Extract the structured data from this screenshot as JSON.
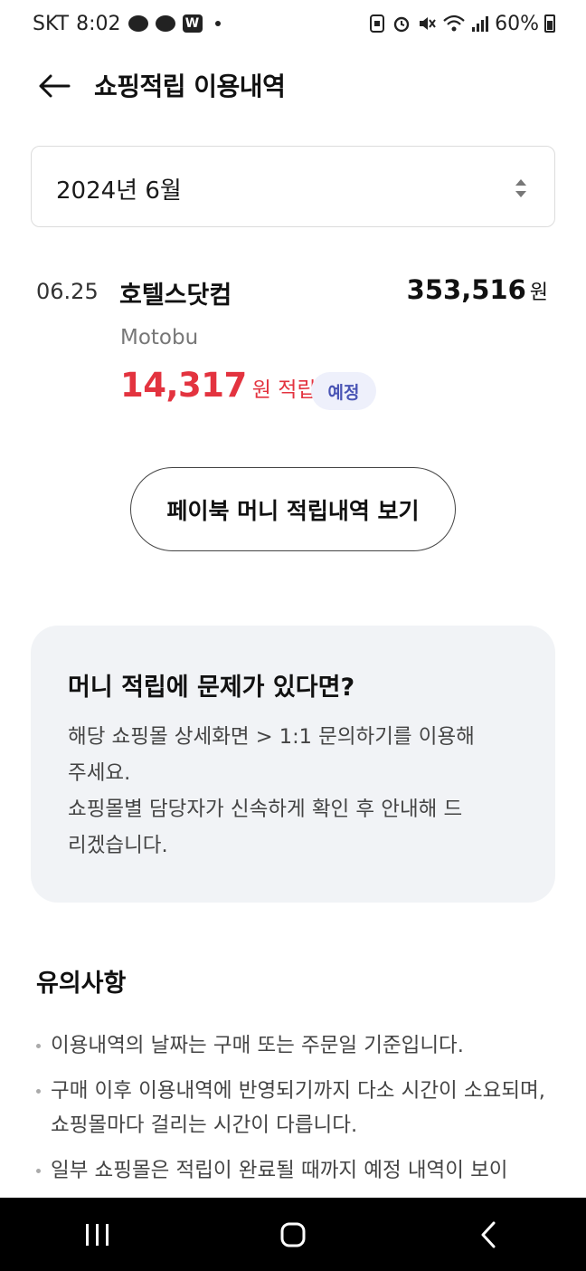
{
  "status_bar": {
    "carrier": "SKT",
    "time": "8:02",
    "app_badge": "W",
    "battery_text": "60%"
  },
  "header": {
    "title": "쇼핑적립 이용내역"
  },
  "month_select": {
    "value": "2024년 6월"
  },
  "transaction": {
    "date": "06.25",
    "merchant": "호텔스닷컴",
    "amount": "353,516",
    "amount_unit": "원",
    "location": "Motobu",
    "reward_amount": "14,317",
    "reward_suffix": "원 적립",
    "status": "예정"
  },
  "history_button": {
    "label": "페이북 머니 적립내역 보기"
  },
  "info_box": {
    "title": "머니 적립에 문제가 있다면?",
    "line1": "해당 쇼핑몰 상세화면 > 1:1 문의하기를 이용해",
    "line2": "주세요.",
    "line3": "쇼핑몰별 담당자가 신속하게 확인 후 안내해 드",
    "line4": "리겠습니다."
  },
  "notice": {
    "title": "유의사항",
    "items": [
      "이용내역의 날짜는 구매 또는 주문일 기준입니다.",
      "구매 이후 이용내역에 반영되기까지 다소 시간이 소요되며, 쇼핑몰마다 걸리는 시간이 다릅니다.",
      "일부 쇼핑몰은 적립이 완료될 때까지 예정 내역이 보이"
    ]
  },
  "colors": {
    "reward_red": "#e3333f",
    "badge_bg": "#eef0fb",
    "badge_text": "#4a55b5",
    "info_bg": "#f1f3f6"
  }
}
